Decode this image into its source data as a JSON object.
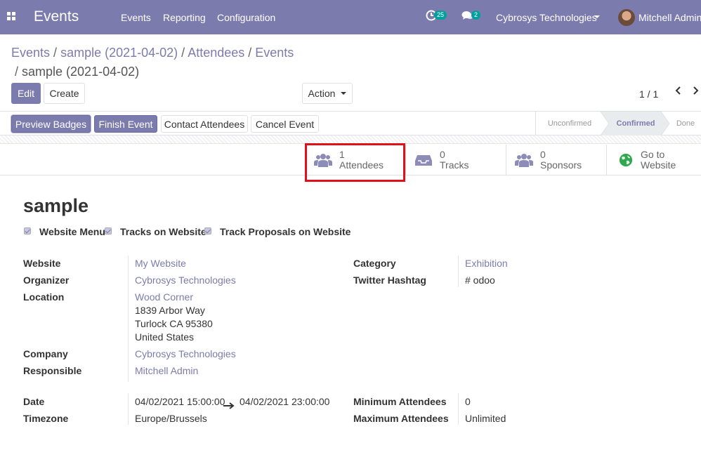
{
  "navbar": {
    "app_name": "Events",
    "menus": [
      "Events",
      "Reporting",
      "Configuration"
    ],
    "activity_badge": "25",
    "messages_badge": "2",
    "company": "Cybrosys Technologies",
    "user": "Mitchell Admin"
  },
  "breadcrumb": {
    "items": [
      "Events",
      "sample (2021-04-02)",
      "Attendees",
      "Events"
    ],
    "current": "sample (2021-04-02)"
  },
  "controls": {
    "edit": "Edit",
    "create": "Create",
    "action": "Action",
    "pager": "1 / 1"
  },
  "header": {
    "buttons": [
      "Preview Badges",
      "Finish Event",
      "Contact Attendees",
      "Cancel Event"
    ],
    "stages": [
      "Unconfirmed",
      "Confirmed",
      "Done"
    ],
    "active_stage": "Confirmed"
  },
  "smart_buttons": [
    {
      "count": "1",
      "label": "Attendees",
      "icon": "users-icon"
    },
    {
      "count": "0",
      "label": "Tracks",
      "icon": "inbox-icon"
    },
    {
      "count": "0",
      "label": "Sponsors",
      "icon": "users-icon"
    },
    {
      "count": "Go to",
      "label": "Website",
      "icon": "globe-icon"
    }
  ],
  "form": {
    "title": "sample",
    "checkboxes": [
      "Website Menu",
      "Tracks on Website",
      "Track Proposals on Website"
    ],
    "website_label": "Website",
    "website": "My Website",
    "organizer_label": "Organizer",
    "organizer": "Cybrosys Technologies",
    "location_label": "Location",
    "location_lines": [
      "Wood Corner",
      "1839 Arbor Way",
      "Turlock CA 95380",
      "United States"
    ],
    "company_label": "Company",
    "company": "Cybrosys Technologies",
    "responsible_label": "Responsible",
    "responsible": "Mitchell Admin",
    "category_label": "Category",
    "category": "Exhibition",
    "hashtag_label": "Twitter Hashtag",
    "hashtag": "# odoo",
    "date_label": "Date",
    "date_begin": "04/02/2021 15:00:00",
    "date_end": "04/02/2021 23:00:00",
    "timezone_label": "Timezone",
    "timezone": "Europe/Brussels",
    "min_label": "Minimum Attendees",
    "min": "0",
    "max_label": "Maximum Attendees",
    "max": "Unlimited"
  },
  "colors": {
    "brand": "#7c7bad",
    "highlight": "#e0111b",
    "badge": "#00a09d"
  }
}
